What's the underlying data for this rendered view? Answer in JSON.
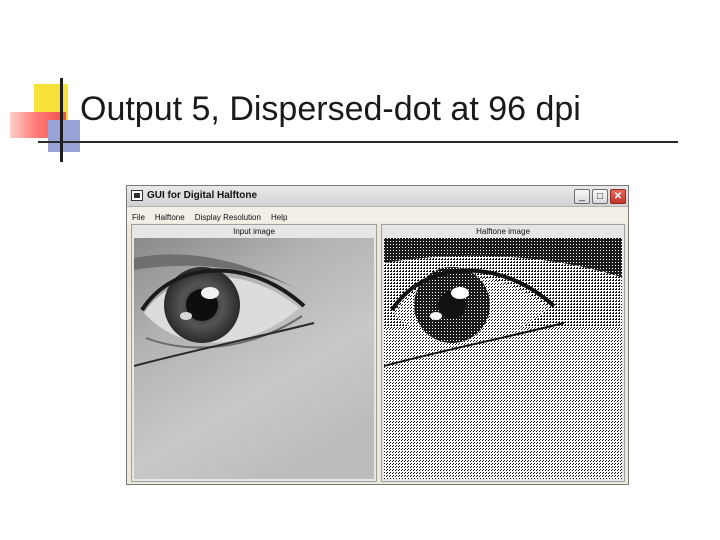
{
  "slide": {
    "title": "Output 5, Dispersed-dot at 96 dpi"
  },
  "window": {
    "title": "GUI for Digital Halftone",
    "icon": "app-window-icon",
    "controls": {
      "minimize": "_",
      "maximize": "□",
      "close": "✕"
    }
  },
  "menu": {
    "items": [
      "File",
      "Halftone",
      "Display Resolution",
      "Help"
    ]
  },
  "panels": {
    "input_label": "Input image",
    "output_label": "Halftone image"
  }
}
